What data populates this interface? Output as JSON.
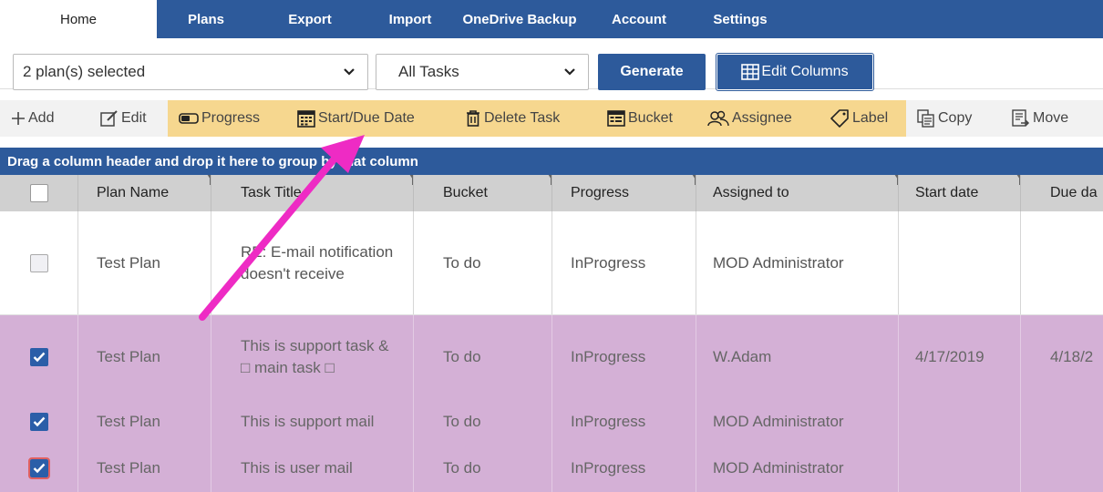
{
  "nav": {
    "tabs": [
      {
        "label": "Home"
      },
      {
        "label": "Plans"
      },
      {
        "label": "Export"
      },
      {
        "label": "Import"
      },
      {
        "label": "OneDrive Backup"
      },
      {
        "label": "Account"
      },
      {
        "label": "Settings"
      }
    ]
  },
  "controls": {
    "plan_select": "2 plan(s) selected",
    "task_select": "All Tasks",
    "generate": "Generate",
    "edit_columns": "Edit Columns"
  },
  "toolbar": {
    "add": "Add",
    "edit": "Edit",
    "progress": "Progress",
    "start_due": "Start/Due Date",
    "delete": "Delete Task",
    "bucket": "Bucket",
    "assignee": "Assignee",
    "label": "Label",
    "copy": "Copy",
    "move": "Move"
  },
  "groupbar": "Drag a column header and drop it here to group by that column",
  "grid": {
    "headers": [
      "Plan Name",
      "Task Title",
      "Bucket",
      "Progress",
      "Assigned to",
      "Start date",
      "Due da"
    ],
    "rows": [
      {
        "checked": false,
        "plan": "Test Plan",
        "title": "RE: E-mail notification doesn't receive",
        "bucket": "To do",
        "progress": "InProgress",
        "assigned": "MOD Administrator",
        "start": "",
        "due": ""
      },
      {
        "checked": true,
        "plan": "Test Plan",
        "title": "This is support task & □ main task □",
        "bucket": "To do",
        "progress": "InProgress",
        "assigned": "W.Adam",
        "start": "4/17/2019",
        "due": "4/18/2"
      },
      {
        "checked": true,
        "plan": "Test Plan",
        "title": "This is support mail",
        "bucket": "To do",
        "progress": "InProgress",
        "assigned": "MOD Administrator",
        "start": "",
        "due": ""
      },
      {
        "checked": true,
        "plan": "Test Plan",
        "title": "This is user mail",
        "bucket": "To do",
        "progress": "InProgress",
        "assigned": "MOD Administrator",
        "start": "",
        "due": ""
      }
    ]
  },
  "colors": {
    "nav_blue": "#2d5a9b",
    "toolbar_highlight": "#f6d78f",
    "selected_row": "#d4b0d6",
    "annotation_arrow": "#ee2bc4"
  }
}
